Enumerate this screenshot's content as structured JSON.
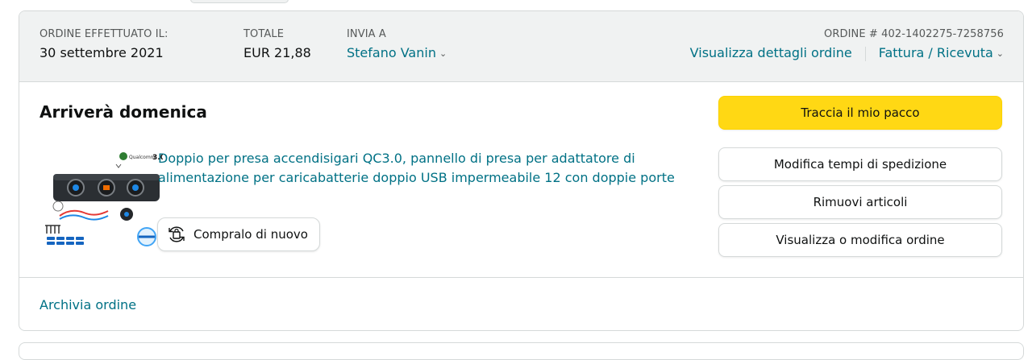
{
  "order": {
    "placed_label": "ORDINE EFFETTUATO IL:",
    "placed_date": "30 settembre 2021",
    "total_label": "TOTALE",
    "total_value": "EUR 21,88",
    "ship_to_label": "INVIA A",
    "ship_to_name": "Stefano Vanin",
    "order_number": "ORDINE # 402-1402275-7258756",
    "details_link": "Visualizza dettagli ordine",
    "invoice_link": "Fattura / Ricevuta"
  },
  "shipment": {
    "status": "Arriverà domenica",
    "product_title": "Doppio per presa accendisigari QC3.0, pannello di presa per adattatore di alimentazione per caricabatterie doppio USB impermeabile 12 con doppie porte",
    "buy_again_label": "Compralo di nuovo",
    "product_image_badge": "3.0"
  },
  "actions": {
    "track": "Traccia il mio pacco",
    "change_shipping": "Modifica tempi di spedizione",
    "remove_items": "Rimuovi articoli",
    "view_edit_order": "Visualizza o modifica ordine"
  },
  "footer": {
    "archive_link": "Archivia ordine"
  },
  "colors": {
    "link": "#007185",
    "primary_button": "#ffd814",
    "header_bg": "#f0f2f2",
    "border": "#d5d9d9"
  }
}
